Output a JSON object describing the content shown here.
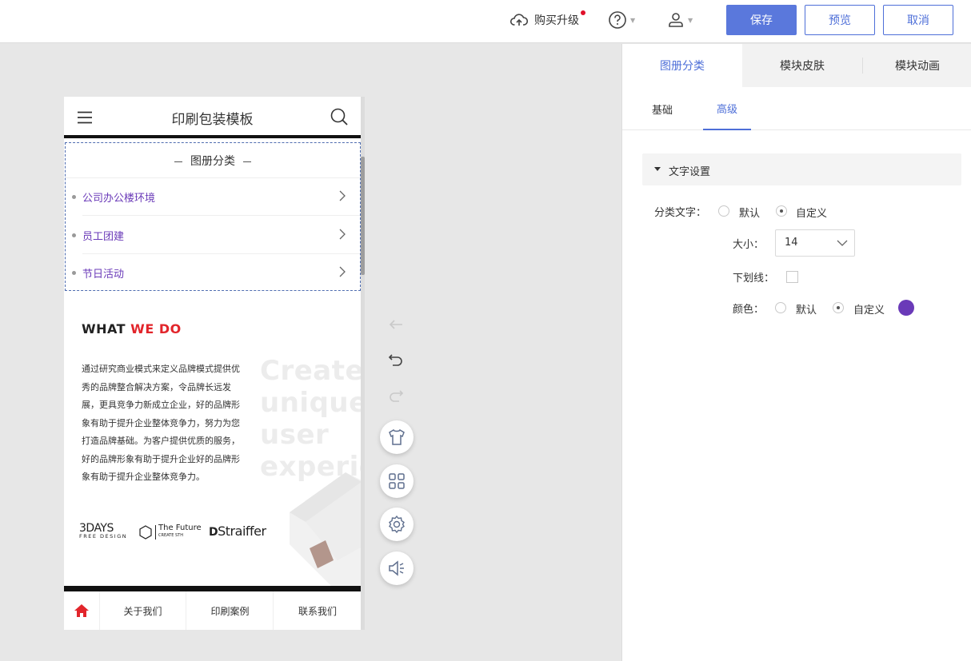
{
  "topbar": {
    "upgrade_label": "购买升级",
    "save_label": "保存",
    "preview_label": "预览",
    "cancel_label": "取消"
  },
  "preview": {
    "header_title": "印刷包装模板",
    "category_title": "图册分类",
    "categories": [
      {
        "label": "公司办公楼环境"
      },
      {
        "label": "员工团建"
      },
      {
        "label": "节日活动"
      }
    ],
    "heading_part1": "WHAT",
    "heading_part2": "WE DO",
    "paragraph_lines": [
      "通过研究商业模式来定义品牌模式提供优",
      "秀的品牌整合解决方案，令品牌长远发",
      "展，更具竞争力新成立企业，好的品牌形",
      "象有助于提升企业整体竞争力，努力为您",
      "打造品牌基础。为客户提供优质的服务，",
      "好的品牌形象有助于提升企业好的品牌形",
      "象有助于提升企业整体竞争力。"
    ],
    "ghost_lines": [
      "Create",
      "unique user",
      "experience"
    ],
    "logos": {
      "days_main": "3DAYS",
      "days_sub": "FREE DESIGN",
      "future_main": "The Future",
      "future_sub": "CREATE STH",
      "straiffer": "Straiffer"
    },
    "bottom_nav": [
      {
        "label": "关于我们"
      },
      {
        "label": "印刷案例"
      },
      {
        "label": "联系我们"
      }
    ]
  },
  "panel": {
    "tabs": [
      {
        "label": "图册分类"
      },
      {
        "label": "模块皮肤"
      },
      {
        "label": "模块动画"
      }
    ],
    "subtabs": [
      {
        "label": "基础"
      },
      {
        "label": "高级"
      }
    ],
    "section_title": "文字设置",
    "category_text_label": "分类文字：",
    "option_default": "默认",
    "option_custom": "自定义",
    "size_label": "大小：",
    "size_value": "14",
    "underline_label": "下划线：",
    "color_label": "颜色：",
    "swatch_color": "#6a3ab8"
  },
  "colors": {
    "accent": "#4e6fd8",
    "brand_red": "#e2252b",
    "category_text": "#6a3ab8"
  }
}
